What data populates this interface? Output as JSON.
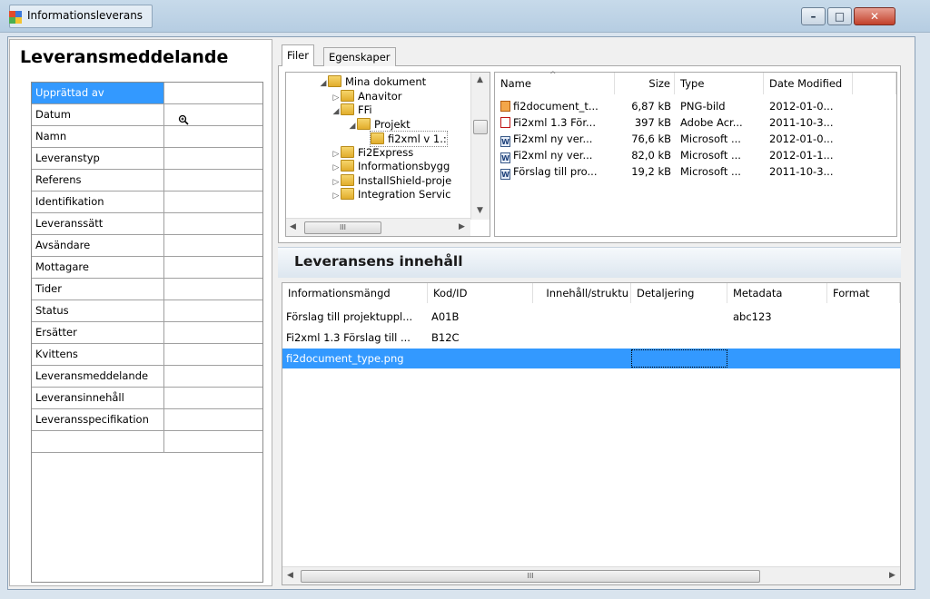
{
  "window": {
    "title": "Informationsleverans",
    "icon": "app-window-icon"
  },
  "left": {
    "title": "Leveransmeddelande",
    "rows": [
      "Upprättad av",
      "Datum",
      "Namn",
      "Leveranstyp",
      "Referens",
      "Identifikation",
      "Leveranssätt",
      "Avsändare",
      "Mottagare",
      "Tider",
      "Status",
      "Ersätter",
      "Kvittens",
      "Leveransmeddelande",
      "Leveransinnehåll",
      "Leveransspecifikation",
      ""
    ],
    "selected": "Upprättad av"
  },
  "tabs": [
    {
      "label": "Filer",
      "active": true
    },
    {
      "label": "Egenskaper",
      "active": false
    }
  ],
  "tree": [
    {
      "label": "Mina dokument",
      "expanded": true
    },
    {
      "label": "Anavitor",
      "expanded": false
    },
    {
      "label": "FFi",
      "expanded": true
    },
    {
      "label": "Projekt",
      "expanded": true
    },
    {
      "label": "fi2xml v 1.:",
      "expanded": false
    },
    {
      "label": "Fi2Express",
      "expanded": false
    },
    {
      "label": "Informationsbygg",
      "expanded": false
    },
    {
      "label": "InstallShield-proje",
      "expanded": false
    },
    {
      "label": "Integration Servic",
      "expanded": false
    }
  ],
  "tree_scroll_label": "III",
  "files": {
    "columns": [
      "Name",
      "Size",
      "Type",
      "Date Modified"
    ],
    "rows": [
      {
        "name": "fi2document_t...",
        "size": "6,87 kB",
        "type": "PNG-bild",
        "date": "2012-01-0...",
        "icon": "png-file-icon"
      },
      {
        "name": "Fi2xml 1.3 För...",
        "size": "397 kB",
        "type": "Adobe Acr...",
        "date": "2011-10-3...",
        "icon": "pdf-file-icon"
      },
      {
        "name": "Fi2xml ny ver...",
        "size": "76,6 kB",
        "type": "Microsoft ...",
        "date": "2012-01-0...",
        "icon": "word-file-icon"
      },
      {
        "name": "Fi2xml ny ver...",
        "size": "82,0 kB",
        "type": "Microsoft ...",
        "date": "2012-01-1...",
        "icon": "word-file-icon"
      },
      {
        "name": "Förslag till pro...",
        "size": "19,2 kB",
        "type": "Microsoft ...",
        "date": "2011-10-3...",
        "icon": "word-file-icon"
      }
    ]
  },
  "content": {
    "title": "Leveransens innehåll",
    "columns": [
      "Informationsmängd",
      "Kod/ID",
      "Innehåll/struktu",
      "Detaljering",
      "Metadata",
      "Format"
    ],
    "rows": [
      {
        "info": "Förslag till projektuppl...",
        "kod": "A01B",
        "innehall": "",
        "detaljering": "",
        "metadata": "abc123",
        "format": ""
      },
      {
        "info": "Fi2xml 1.3 Förslag till ...",
        "kod": "B12C",
        "innehall": "",
        "detaljering": "",
        "metadata": "",
        "format": ""
      },
      {
        "info": "fi2document_type.png",
        "kod": "",
        "innehall": "",
        "detaljering": "",
        "metadata": "",
        "format": ""
      }
    ],
    "selected_row": 2,
    "hscroll_label": "III"
  },
  "colors": {
    "selection": "#3399ff",
    "titlebar": "#c7daea",
    "close_button": "#c2402a"
  }
}
